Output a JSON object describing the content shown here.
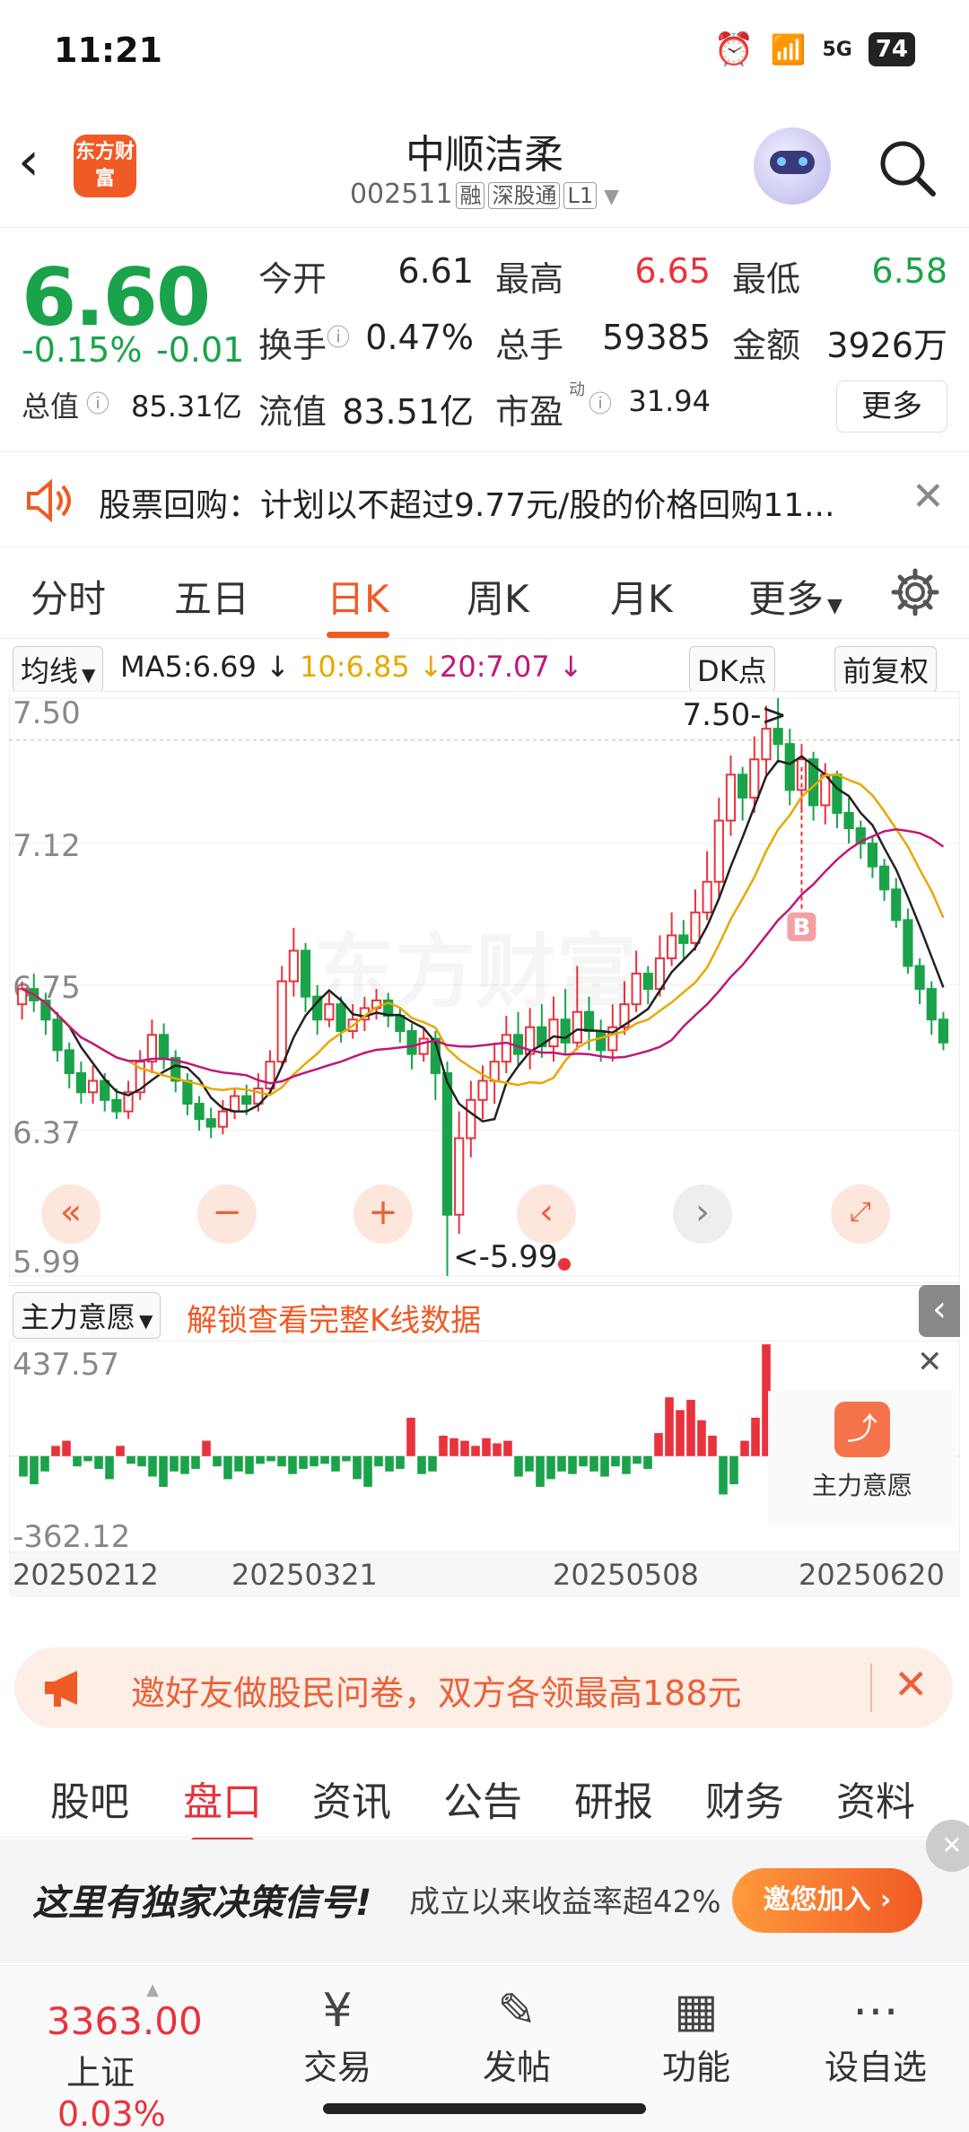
{
  "status": {
    "time": "11:21",
    "network": "5G",
    "battery": "74"
  },
  "header": {
    "logo_text": "东方财富",
    "stock_name": "中顺洁柔",
    "stock_code": "002511",
    "tags": [
      "融",
      "深股通",
      "L1"
    ]
  },
  "quote": {
    "price": "6.60",
    "change_pct": "-0.15%",
    "change": "-0.01",
    "open_label": "今开",
    "open": "6.61",
    "high_label": "最高",
    "high": "6.65",
    "low_label": "最低",
    "low": "6.58",
    "turnover_label": "换手",
    "turnover": "0.47%",
    "volume_label": "总手",
    "volume": "59385",
    "amount_label": "金额",
    "amount": "3926万",
    "mktcap_label": "总值",
    "mktcap": "85.31亿",
    "float_label": "流值",
    "float": "83.51亿",
    "pe_label": "市盈",
    "pe_sup": "动",
    "pe": "31.94",
    "more_label": "更多"
  },
  "notice": {
    "text": "股票回购：计划以不超过9.77元/股的价格回购11..."
  },
  "ktabs": [
    "分时",
    "五日",
    "日K",
    "周K",
    "月K",
    "更多"
  ],
  "ktab_active": 2,
  "ma": {
    "selector": "均线",
    "ma5": "MA5:6.69",
    "ma10": "10:6.85",
    "ma20": "20:7.07",
    "dk_label": "DK点",
    "adjust_label": "前复权",
    "ma5_color": "#222222",
    "ma10_color": "#e8a800",
    "ma20_color": "#c0177a"
  },
  "indicator": {
    "selector": "主力意愿",
    "unlock_text": "解锁查看完整K线数据",
    "badge_label": "主力意愿"
  },
  "chart_data": [
    {
      "type": "candlestick",
      "ylim": [
        5.99,
        7.5
      ],
      "y_ticks": [
        "7.50",
        "7.12",
        "6.75",
        "6.37",
        "5.99"
      ],
      "annotations": {
        "high": "7.50->",
        "low": "<-5.99",
        "signal": "B"
      },
      "candles": [
        [
          6.7,
          6.74,
          6.76,
          6.66
        ],
        [
          6.74,
          6.71,
          6.78,
          6.68
        ],
        [
          6.71,
          6.66,
          6.73,
          6.62
        ],
        [
          6.66,
          6.58,
          6.68,
          6.55
        ],
        [
          6.58,
          6.52,
          6.6,
          6.48
        ],
        [
          6.52,
          6.47,
          6.55,
          6.44
        ],
        [
          6.47,
          6.5,
          6.54,
          6.44
        ],
        [
          6.5,
          6.45,
          6.52,
          6.42
        ],
        [
          6.45,
          6.42,
          6.48,
          6.4
        ],
        [
          6.42,
          6.47,
          6.5,
          6.4
        ],
        [
          6.47,
          6.55,
          6.58,
          6.45
        ],
        [
          6.55,
          6.62,
          6.66,
          6.52
        ],
        [
          6.62,
          6.56,
          6.65,
          6.53
        ],
        [
          6.56,
          6.5,
          6.58,
          6.47
        ],
        [
          6.5,
          6.44,
          6.52,
          6.41
        ],
        [
          6.44,
          6.4,
          6.46,
          6.37
        ],
        [
          6.4,
          6.38,
          6.43,
          6.35
        ],
        [
          6.38,
          6.42,
          6.45,
          6.36
        ],
        [
          6.42,
          6.46,
          6.48,
          6.4
        ],
        [
          6.46,
          6.44,
          6.49,
          6.41
        ],
        [
          6.44,
          6.48,
          6.52,
          6.42
        ],
        [
          6.48,
          6.55,
          6.58,
          6.46
        ],
        [
          6.55,
          6.76,
          6.8,
          6.54
        ],
        [
          6.76,
          6.84,
          6.9,
          6.72
        ],
        [
          6.84,
          6.72,
          6.86,
          6.68
        ],
        [
          6.72,
          6.66,
          6.75,
          6.62
        ],
        [
          6.66,
          6.7,
          6.73,
          6.64
        ],
        [
          6.7,
          6.63,
          6.72,
          6.6
        ],
        [
          6.63,
          6.66,
          6.7,
          6.61
        ],
        [
          6.66,
          6.69,
          6.72,
          6.63
        ],
        [
          6.69,
          6.71,
          6.74,
          6.66
        ],
        [
          6.71,
          6.67,
          6.73,
          6.64
        ],
        [
          6.67,
          6.63,
          6.69,
          6.6
        ],
        [
          6.63,
          6.57,
          6.65,
          6.53
        ],
        [
          6.57,
          6.61,
          6.64,
          6.55
        ],
        [
          6.61,
          6.52,
          6.63,
          6.45
        ],
        [
          6.52,
          6.15,
          6.55,
          5.99
        ],
        [
          6.15,
          6.35,
          6.42,
          6.1
        ],
        [
          6.35,
          6.45,
          6.5,
          6.3
        ],
        [
          6.45,
          6.5,
          6.54,
          6.4
        ],
        [
          6.5,
          6.55,
          6.6,
          6.44
        ],
        [
          6.55,
          6.62,
          6.67,
          6.52
        ],
        [
          6.62,
          6.57,
          6.68,
          6.54
        ],
        [
          6.57,
          6.64,
          6.69,
          6.53
        ],
        [
          6.64,
          6.59,
          6.7,
          6.56
        ],
        [
          6.59,
          6.66,
          6.72,
          6.55
        ],
        [
          6.66,
          6.6,
          6.74,
          6.57
        ],
        [
          6.6,
          6.68,
          6.8,
          6.58
        ],
        [
          6.68,
          6.63,
          6.72,
          6.58
        ],
        [
          6.63,
          6.58,
          6.66,
          6.55
        ],
        [
          6.58,
          6.64,
          6.7,
          6.55
        ],
        [
          6.64,
          6.7,
          6.76,
          6.62
        ],
        [
          6.7,
          6.78,
          6.84,
          6.68
        ],
        [
          6.78,
          6.74,
          6.8,
          6.7
        ],
        [
          6.74,
          6.82,
          6.88,
          6.72
        ],
        [
          6.82,
          6.88,
          6.94,
          6.8
        ],
        [
          6.88,
          6.86,
          6.92,
          6.82
        ],
        [
          6.86,
          6.94,
          7.0,
          6.84
        ],
        [
          6.94,
          7.02,
          7.1,
          6.92
        ],
        [
          7.02,
          7.18,
          7.24,
          6.98
        ],
        [
          7.18,
          7.3,
          7.35,
          7.14
        ],
        [
          7.3,
          7.24,
          7.32,
          7.18
        ],
        [
          7.24,
          7.34,
          7.4,
          7.2
        ],
        [
          7.34,
          7.42,
          7.48,
          7.3
        ],
        [
          7.42,
          7.38,
          7.5,
          7.33
        ],
        [
          7.38,
          7.26,
          7.42,
          7.22
        ],
        [
          7.26,
          7.34,
          7.38,
          7.2
        ],
        [
          7.34,
          7.22,
          7.36,
          7.18
        ],
        [
          7.22,
          7.3,
          7.33,
          7.17
        ],
        [
          7.3,
          7.2,
          7.31,
          7.16
        ],
        [
          7.2,
          7.16,
          7.24,
          7.12
        ],
        [
          7.16,
          7.12,
          7.18,
          7.08
        ],
        [
          7.12,
          7.06,
          7.14,
          7.03
        ],
        [
          7.06,
          7.0,
          7.08,
          6.97
        ],
        [
          7.0,
          6.92,
          7.03,
          6.9
        ],
        [
          6.92,
          6.8,
          6.95,
          6.78
        ],
        [
          6.8,
          6.74,
          6.82,
          6.7
        ],
        [
          6.74,
          6.66,
          6.76,
          6.62
        ],
        [
          6.66,
          6.6,
          6.68,
          6.58
        ]
      ]
    },
    {
      "type": "bar",
      "ylim": [
        -362.12,
        437.57
      ],
      "y_ticks": [
        "437.57",
        "-362.12"
      ],
      "x_labels": [
        "20250212",
        "20250321",
        "20250508",
        "20250620"
      ],
      "values": [
        -80,
        -110,
        -60,
        40,
        60,
        -40,
        -20,
        -50,
        -90,
        40,
        -30,
        -40,
        -80,
        -120,
        -60,
        -70,
        -50,
        60,
        -40,
        -90,
        -60,
        -70,
        -30,
        -20,
        -40,
        -70,
        -50,
        -40,
        -30,
        -60,
        -20,
        -90,
        -120,
        -40,
        -60,
        -50,
        150,
        -70,
        -60,
        80,
        70,
        60,
        40,
        70,
        50,
        60,
        -80,
        -60,
        -120,
        -90,
        -60,
        -70,
        -40,
        -60,
        -80,
        -40,
        -70,
        -30,
        -50,
        90,
        230,
        180,
        220,
        140,
        80,
        -150,
        -110,
        60,
        150,
        437
      ]
    }
  ],
  "survey": {
    "text": "邀好友做股民问卷，双方各领最高188元"
  },
  "btabs": [
    "股吧",
    "盘口",
    "资讯",
    "公告",
    "研报",
    "财务",
    "资料"
  ],
  "btab_active": 1,
  "ad": {
    "headline": "这里有独家决策信号!",
    "sub": "成立以来收益率超42%",
    "cta": "邀您加入"
  },
  "footer": {
    "index_value": "3363.00",
    "index_name": "上证",
    "index_change": "0.03%",
    "items": [
      "交易",
      "发帖",
      "功能",
      "设自选"
    ]
  }
}
